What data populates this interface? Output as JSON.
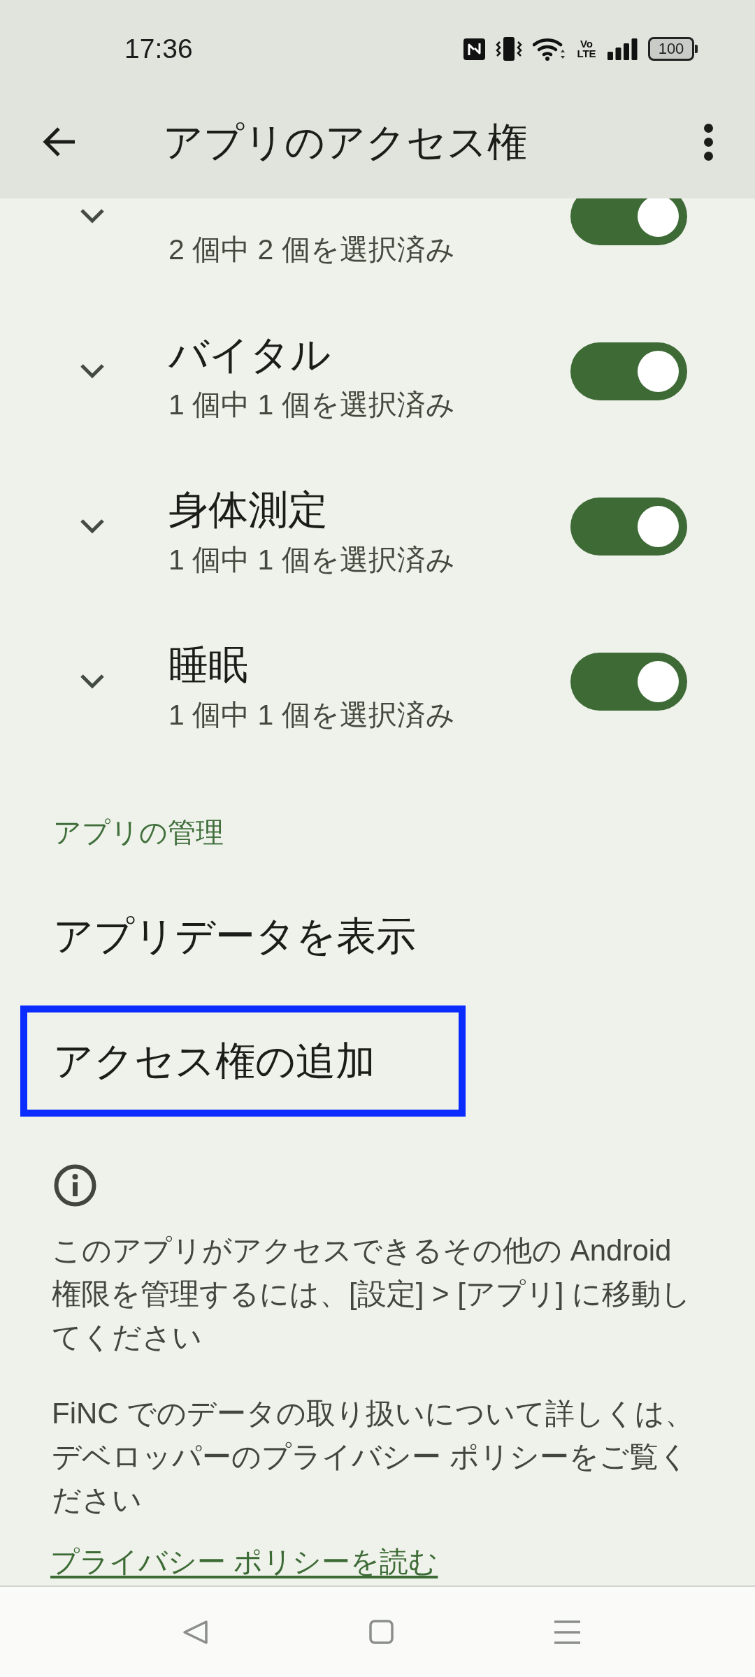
{
  "status_bar": {
    "time": "17:36",
    "network_label": "Vo LTE",
    "battery": "100"
  },
  "app_bar": {
    "title": "アプリのアクセス権"
  },
  "permissions": [
    {
      "subtitle": "2 個中 2 個を選択済み",
      "expanded": false,
      "on": true
    },
    {
      "title": "バイタル",
      "subtitle": "1 個中 1 個を選択済み",
      "expanded": false,
      "on": true
    },
    {
      "title": "身体測定",
      "subtitle": "1 個中 1 個を選択済み",
      "expanded": false,
      "on": true
    },
    {
      "title": "睡眠",
      "subtitle": "1 個中 1 個を選択済み",
      "expanded": false,
      "on": true
    }
  ],
  "management": {
    "header": "アプリの管理",
    "items": [
      {
        "label": "アプリデータを表示",
        "highlighted": false
      },
      {
        "label": "アクセス権の追加",
        "highlighted": true
      }
    ]
  },
  "info": {
    "paragraphs": [
      "このアプリがアクセスできるその他の Android 権限を管理するには、[設定] > [アプリ] に移動してください",
      "FiNC でのデータの取り扱いについて詳しくは、デベロッパーのプライバシー ポリシーをご覧ください"
    ],
    "link": "プライバシー ポリシーを読む"
  }
}
